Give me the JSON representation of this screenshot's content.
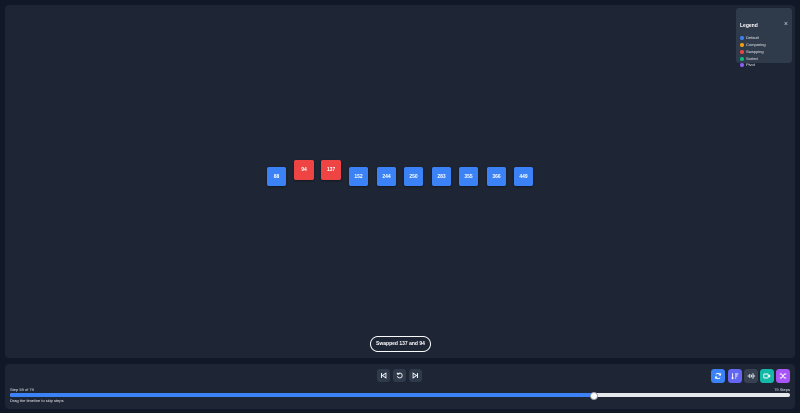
{
  "legend": {
    "title": "Legend",
    "close": "×",
    "items": [
      {
        "label": "Default",
        "color": "#3b82f6"
      },
      {
        "label": "Comparing",
        "color": "#f59e0b"
      },
      {
        "label": "Swapping",
        "color": "#ef4444"
      },
      {
        "label": "Sorted",
        "color": "#10b981"
      },
      {
        "label": "Pivot",
        "color": "#8b5cf6"
      }
    ]
  },
  "array": [
    {
      "value": "88",
      "state": "default"
    },
    {
      "value": "94",
      "state": "swapping"
    },
    {
      "value": "137",
      "state": "swapping"
    },
    {
      "value": "152",
      "state": "default"
    },
    {
      "value": "244",
      "state": "default"
    },
    {
      "value": "250",
      "state": "default"
    },
    {
      "value": "283",
      "state": "default"
    },
    {
      "value": "355",
      "state": "default"
    },
    {
      "value": "366",
      "state": "default"
    },
    {
      "value": "449",
      "state": "default"
    }
  ],
  "status": "Swapped 137 and 94",
  "controls": {
    "step_text": "Step 59 of 79",
    "steps_total": "79 Steps",
    "hint": "Drag the timeline to skip steps",
    "progress": 0.747
  },
  "tools": [
    {
      "icon": "refresh-icon",
      "color": "#3b82f6"
    },
    {
      "icon": "sort-icon",
      "color": "#6366f1"
    },
    {
      "icon": "sound-icon",
      "color": "#374151"
    },
    {
      "icon": "video-icon",
      "color": "#14b8a6"
    },
    {
      "icon": "shuffle-icon",
      "color": "#a855f7"
    }
  ]
}
